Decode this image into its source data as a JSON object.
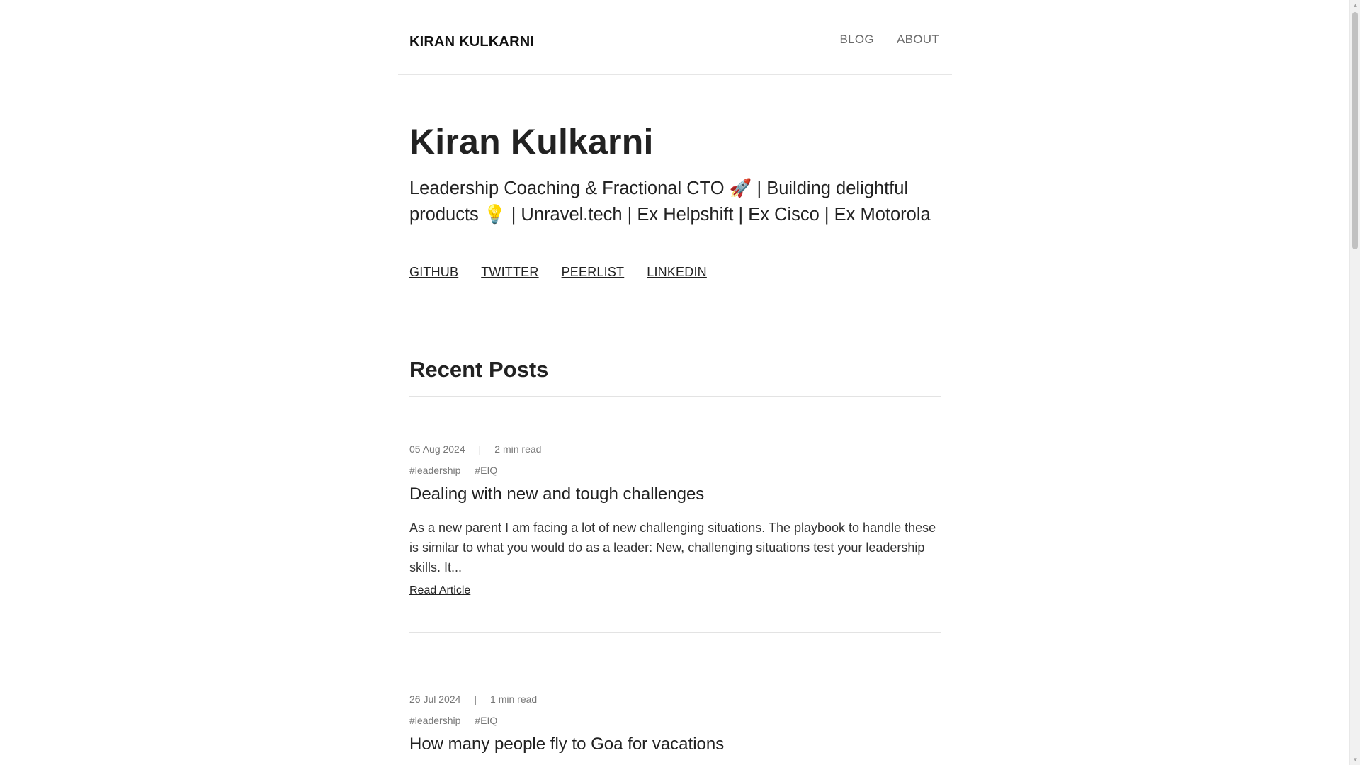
{
  "header": {
    "brand": "KIRAN KULKARNI",
    "nav": [
      {
        "label": "BLOG"
      },
      {
        "label": "ABOUT"
      }
    ]
  },
  "hero": {
    "title": "Kiran Kulkarni",
    "tagline": "Leadership Coaching & Fractional CTO 🚀 | Building delightful products 💡 | Unravel.tech | Ex Helpshift | Ex Cisco | Ex Motorola",
    "social": [
      {
        "label": "GITHUB"
      },
      {
        "label": "TWITTER"
      },
      {
        "label": "PEERLIST"
      },
      {
        "label": "LINKEDIN"
      }
    ]
  },
  "recent_posts": {
    "title": "Recent Posts",
    "posts": [
      {
        "date": "05 Aug 2024",
        "separator": "|",
        "read_time": "2 min read",
        "tags": [
          "#leadership",
          "#EIQ"
        ],
        "title": "Dealing with new and tough challenges",
        "excerpt": "As a new parent I am facing a lot of new challenging situations. The playbook to handle these is similar to what you would do as a leader: New, challenging situations test your leadership skills. It...",
        "read_label": "Read Article"
      },
      {
        "date": "26 Jul 2024",
        "separator": "|",
        "read_time": "1 min read",
        "tags": [
          "#leadership",
          "#EIQ"
        ],
        "title": "How many people fly to Goa for vacations"
      }
    ]
  },
  "scrollbar": {
    "position_fraction": 0.0
  }
}
